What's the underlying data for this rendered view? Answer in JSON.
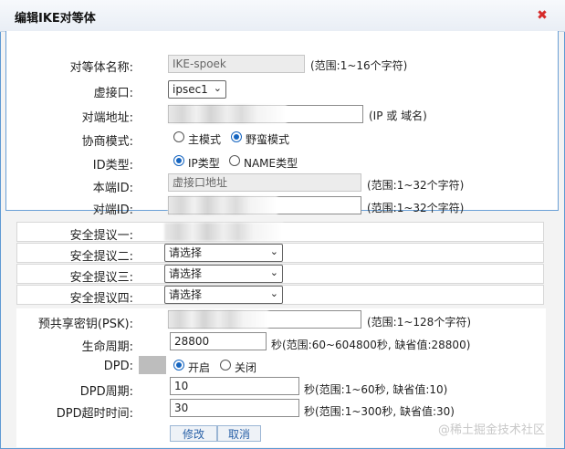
{
  "dialog": {
    "title": "编辑IKE对等体",
    "close_icon": "close-icon"
  },
  "form": {
    "peer_name": {
      "label": "对等体名称:",
      "value": "IKE-spoek",
      "hint": "(范围:1~16个字符)"
    },
    "virtual_interface": {
      "label": "虚接口:",
      "value": "ipsec1"
    },
    "remote_address": {
      "label": "对端地址:",
      "hint": "(IP 或 域名)"
    },
    "negotiation_mode": {
      "label": "协商模式:",
      "options": [
        "主模式",
        "野蛮模式"
      ],
      "selected": "野蛮模式"
    },
    "id_type": {
      "label": "ID类型:",
      "options": [
        "IP类型",
        "NAME类型"
      ],
      "selected": "IP类型"
    },
    "local_id": {
      "label": "本端ID:",
      "value": "虚接口地址",
      "hint": "(范围:1~32个字符)"
    },
    "remote_id": {
      "label": "对端ID:",
      "hint": "(范围:1~32个字符)"
    },
    "proposal1": {
      "label": "安全提议一:"
    },
    "proposal2": {
      "label": "安全提议二:",
      "value": "请选择"
    },
    "proposal3": {
      "label": "安全提议三:",
      "value": "请选择"
    },
    "proposal4": {
      "label": "安全提议四:",
      "value": "请选择"
    },
    "psk": {
      "label": "预共享密钥(PSK):",
      "hint": "(范围:1~128个字符)"
    },
    "lifetime": {
      "label": "生命周期:",
      "value": "28800",
      "hint": "秒(范围:60~604800秒, 缺省值:28800)"
    },
    "dpd": {
      "label": "DPD:",
      "options": [
        "开启",
        "关闭"
      ],
      "selected": "开启"
    },
    "dpd_period": {
      "label": "DPD周期:",
      "value": "10",
      "hint": "秒(范围:1~60秒, 缺省值:10)"
    },
    "dpd_timeout": {
      "label": "DPD超时时间:",
      "value": "30",
      "hint": "秒(范围:1~300秒, 缺省值:30)"
    }
  },
  "buttons": {
    "modify": "修改",
    "cancel": "取消"
  },
  "watermark": "@稀土掘金技术社区",
  "colors": {
    "accent": "#1565c0",
    "close": "#d62b2b",
    "border": "#5f9ad3"
  }
}
